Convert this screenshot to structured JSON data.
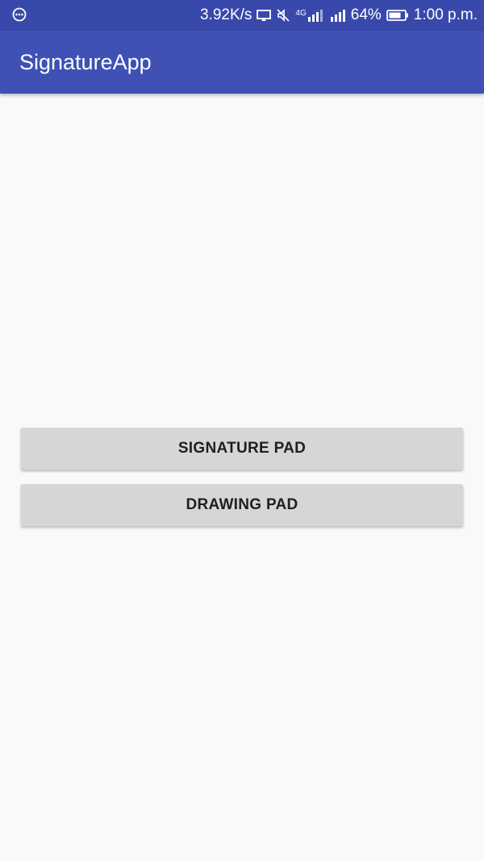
{
  "status_bar": {
    "network_speed": "3.92K/s",
    "network_type": "4G",
    "battery_percent": "64%",
    "time": "1:00 p.m.",
    "icons": [
      "more-circle-icon",
      "cast-icon",
      "mute-icon",
      "signal-icon",
      "battery-icon"
    ]
  },
  "app_bar": {
    "title": "SignatureApp",
    "color": "#3f51b5"
  },
  "buttons": {
    "signature_pad": "SIGNATURE PAD",
    "drawing_pad": "DRAWING PAD"
  }
}
